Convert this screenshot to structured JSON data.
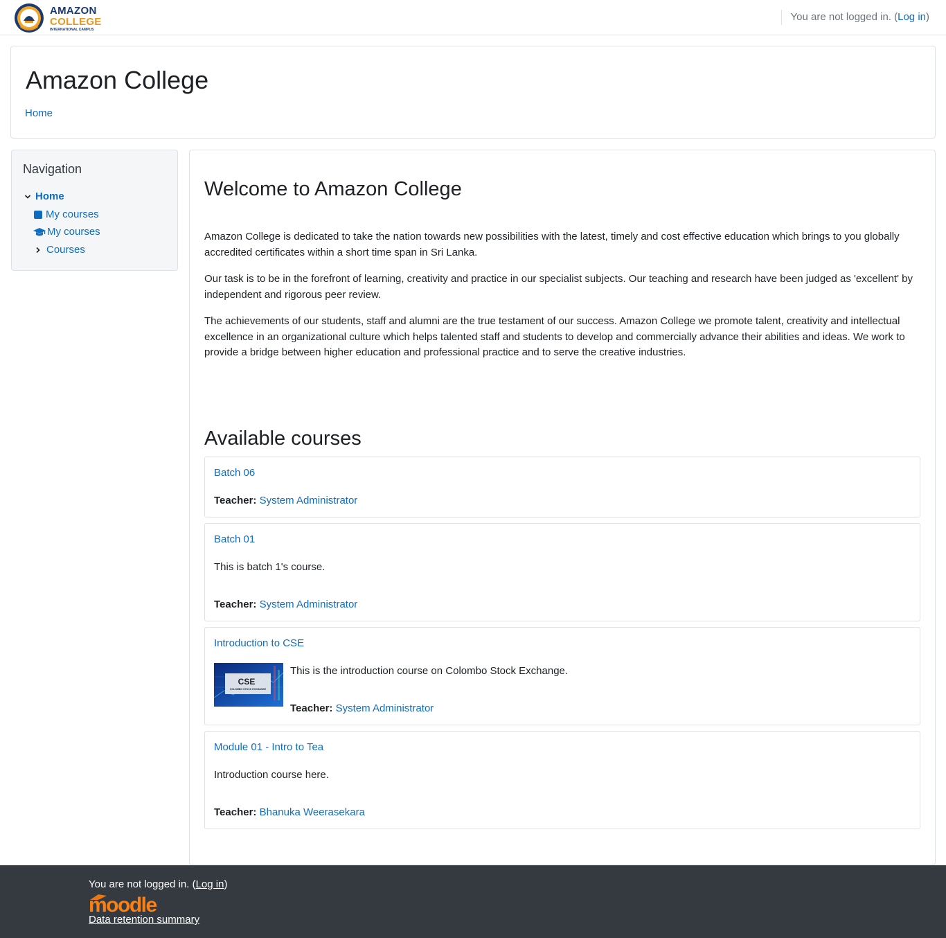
{
  "brand": {
    "logo_line1": "AMAZON",
    "logo_line2": "COLLEGE",
    "logo_line3": "INTERNATIONAL CAMPUS",
    "colors": {
      "navy": "#1b3b6f",
      "orange": "#e9961e"
    }
  },
  "topbar": {
    "login_prefix": "You are not logged in. (",
    "login_link": "Log in",
    "login_suffix": ")"
  },
  "header": {
    "site_title": "Amazon College",
    "breadcrumb_home": "Home"
  },
  "navigation": {
    "title": "Navigation",
    "items": [
      {
        "label": "Home",
        "icon": "chevron-down-icon"
      },
      {
        "label": "My courses",
        "icon": "square-icon"
      },
      {
        "label": "My courses",
        "icon": "graduation-cap-icon"
      },
      {
        "label": "Courses",
        "icon": "chevron-right-icon"
      }
    ]
  },
  "main": {
    "welcome_title": "Welcome to Amazon College",
    "paragraphs": [
      "Amazon College is dedicated to take the nation towards new possibilities with the latest, timely and cost effective education which brings to you globally accredited certificates within a short time span in Sri Lanka.",
      "Our task is to be in the forefront of learning, creativity and practice in our specialist subjects. Our teaching and research have been judged as 'excellent' by independent and rigorous peer review.",
      "The achievements of our students, staff and alumni are the true testament of our success. Amazon College we promote talent, creativity and intellectual excellence in an organizational culture which helps talented staff and students to develop and commercially advance their abilities and ideas. We work to provide a bridge between higher education and professional practice and to serve the creative industries."
    ],
    "available_title": "Available courses",
    "teacher_label": "Teacher:",
    "courses": [
      {
        "name": "Batch 06",
        "summary": "",
        "teacher": "System Administrator"
      },
      {
        "name": "Batch 01",
        "summary": "This is batch 1's course.",
        "teacher": "System Administrator"
      },
      {
        "name": "Introduction to CSE",
        "summary": "This is the introduction course on Colombo Stock Exchange.",
        "teacher": "System Administrator",
        "image_text": "CSE",
        "image_subtext": "COLOMBO STOCK EXCHANGE"
      },
      {
        "name": "Module 01 - Intro to Tea",
        "summary": "Introduction course here.",
        "teacher": "Bhanuka Weerasekara"
      }
    ]
  },
  "footer": {
    "login_prefix": "You are not logged in. (",
    "login_link": "Log in",
    "login_suffix": ")",
    "moodle_logo": "moodle",
    "data_retention": "Data retention summary"
  },
  "colors": {
    "link": "#0f6cbf",
    "footer_bg": "#343a40",
    "border": "#dee2e6",
    "moodle_orange": "#f98012"
  }
}
